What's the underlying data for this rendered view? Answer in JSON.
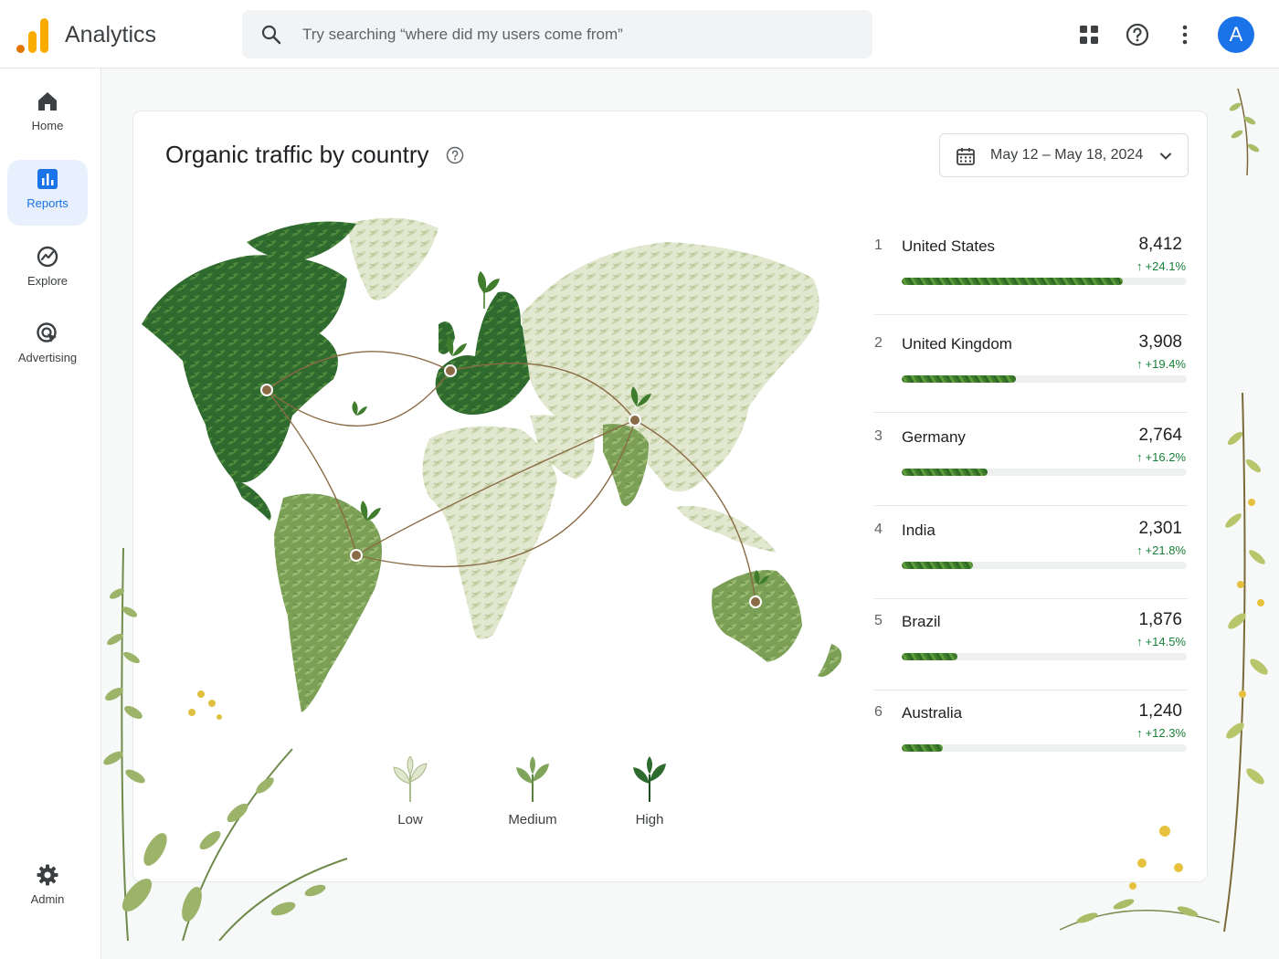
{
  "app": {
    "title": "Analytics"
  },
  "search": {
    "placeholder": "Try searching “where did my users come from”"
  },
  "user": {
    "initial": "A"
  },
  "sidebar": {
    "items": [
      {
        "label": "Home",
        "icon": "home-icon"
      },
      {
        "label": "Reports",
        "icon": "reports-icon",
        "active": true
      },
      {
        "label": "Explore",
        "icon": "explore-icon"
      },
      {
        "label": "Advertising",
        "icon": "advertising-icon"
      },
      {
        "label": "Admin",
        "icon": "gear-icon"
      }
    ]
  },
  "card": {
    "title": "Organic traffic by country",
    "date_range": "May 12 – May 18, 2024"
  },
  "legend": {
    "low": "Low",
    "medium": "Medium",
    "high": "High"
  },
  "countries": [
    {
      "rank": "1",
      "name": "United States",
      "value": "8,412",
      "change": "+24.1%",
      "share": 0.776
    },
    {
      "rank": "2",
      "name": "United Kingdom",
      "value": "3,908",
      "change": "+19.4%",
      "share": 0.4
    },
    {
      "rank": "3",
      "name": "Germany",
      "value": "2,764",
      "change": "+16.2%",
      "share": 0.3
    },
    {
      "rank": "4",
      "name": "India",
      "value": "2,301",
      "change": "+21.8%",
      "share": 0.25
    },
    {
      "rank": "5",
      "name": "Brazil",
      "value": "1,876",
      "change": "+14.5%",
      "share": 0.195
    },
    {
      "rank": "6",
      "name": "Australia",
      "value": "1,240",
      "change": "+12.3%",
      "share": 0.145
    }
  ],
  "colors": {
    "brand_blue": "#1a73e8",
    "positive_green": "#188038",
    "traffic_high": "#2e6b2e",
    "traffic_medium": "#7fa45a",
    "traffic_low": "#dfe6cc"
  }
}
